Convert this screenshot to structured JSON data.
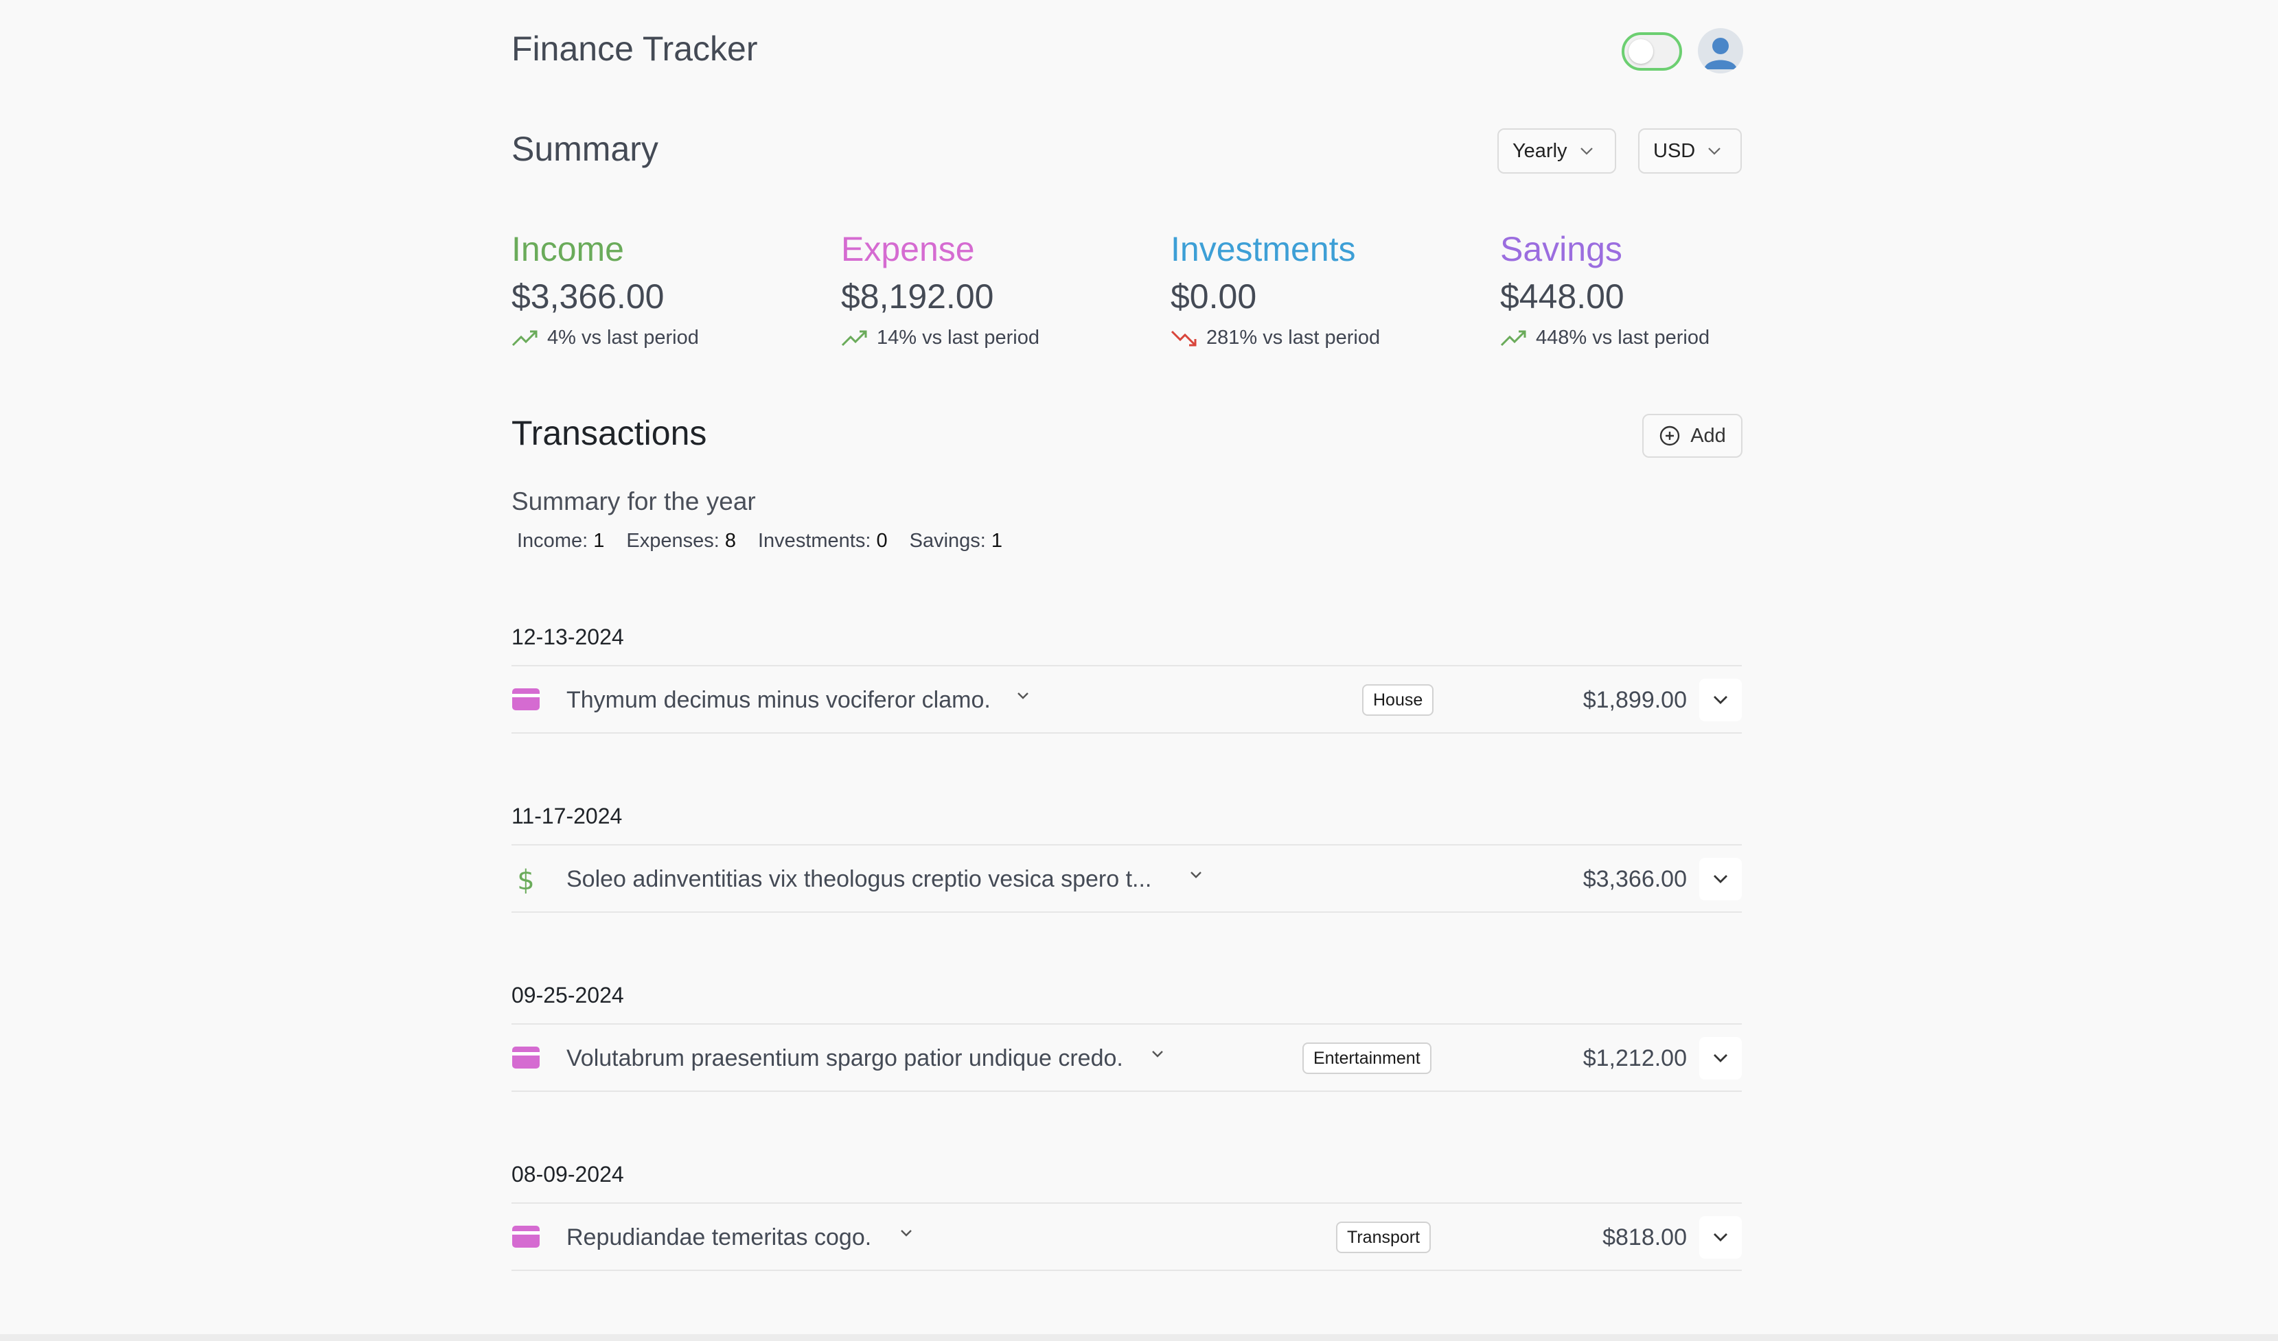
{
  "header": {
    "title": "Finance Tracker",
    "theme_toggle_on": false,
    "avatar_icon": "user-avatar-icon"
  },
  "summary": {
    "title": "Summary",
    "period_select": "Yearly",
    "currency_select": "USD",
    "stats": [
      {
        "label": "Income",
        "value": "$3,366.00",
        "change": "4% vs last period",
        "trend": "up",
        "color": "#6aab5a"
      },
      {
        "label": "Expense",
        "value": "$8,192.00",
        "change": "14% vs last period",
        "trend": "up",
        "color": "#d56bd1"
      },
      {
        "label": "Investments",
        "value": "$0.00",
        "change": "281% vs last period",
        "trend": "down",
        "color": "#3d9fd6"
      },
      {
        "label": "Savings",
        "value": "$448.00",
        "change": "448% vs last period",
        "trend": "up",
        "color": "#9b6ddf"
      }
    ]
  },
  "transactions": {
    "title": "Transactions",
    "add_label": "Add",
    "year_summary_title": "Summary for the year",
    "counts": [
      {
        "label": "Income:",
        "value": "1"
      },
      {
        "label": "Expenses:",
        "value": "8"
      },
      {
        "label": "Investments:",
        "value": "0"
      },
      {
        "label": "Savings:",
        "value": "1"
      }
    ],
    "groups": [
      {
        "date": "12-13-2024",
        "type": "expense",
        "icon": "credit-card-icon",
        "description": "Thymum decimus minus vociferor clamo.",
        "tag": "House",
        "amount": "$1,899.00"
      },
      {
        "date": "11-17-2024",
        "type": "income",
        "icon": "dollar-sign-icon",
        "description": "Soleo adinventitias vix theologus creptio vesica spero t...",
        "tag": "",
        "amount": "$3,366.00"
      },
      {
        "date": "09-25-2024",
        "type": "expense",
        "icon": "credit-card-icon",
        "description": "Volutabrum praesentium spargo patior undique credo.",
        "tag": "Entertainment",
        "amount": "$1,212.00"
      },
      {
        "date": "08-09-2024",
        "type": "expense",
        "icon": "credit-card-icon",
        "description": "Repudiandae temeritas cogo.",
        "tag": "Transport",
        "amount": "$818.00"
      }
    ]
  },
  "colors": {
    "toggle_border": "#6ccf71",
    "expense_icon": "#d56bd1",
    "income_icon": "#6aab5a",
    "trend_up": "#6aab5a",
    "trend_down": "#d9453b"
  }
}
